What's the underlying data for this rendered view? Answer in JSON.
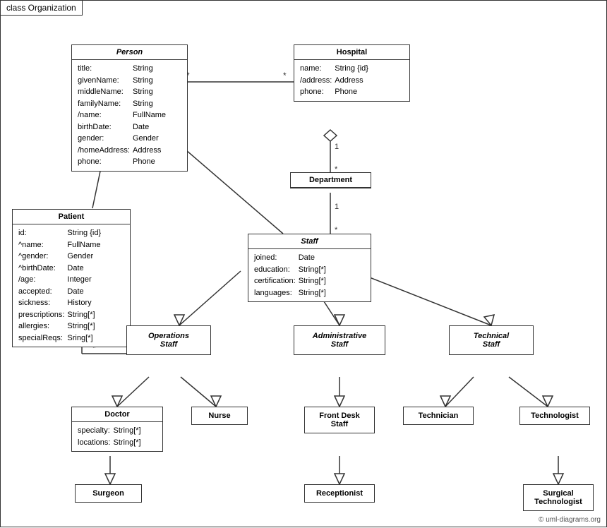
{
  "diagram": {
    "label": "class Organization",
    "classes": {
      "person": {
        "title": "Person",
        "attrs": [
          [
            "title:",
            "String"
          ],
          [
            "givenName:",
            "String"
          ],
          [
            "middleName:",
            "String"
          ],
          [
            "familyName:",
            "String"
          ],
          [
            "/name:",
            "FullName"
          ],
          [
            "birthDate:",
            "Date"
          ],
          [
            "gender:",
            "Gender"
          ],
          [
            "/homeAddress:",
            "Address"
          ],
          [
            "phone:",
            "Phone"
          ]
        ]
      },
      "hospital": {
        "title": "Hospital",
        "attrs": [
          [
            "name:",
            "String {id}"
          ],
          [
            "/address:",
            "Address"
          ],
          [
            "phone:",
            "Phone"
          ]
        ]
      },
      "patient": {
        "title": "Patient",
        "attrs": [
          [
            "id:",
            "String {id}"
          ],
          [
            "^name:",
            "FullName"
          ],
          [
            "^gender:",
            "Gender"
          ],
          [
            "^birthDate:",
            "Date"
          ],
          [
            "/age:",
            "Integer"
          ],
          [
            "accepted:",
            "Date"
          ],
          [
            "sickness:",
            "History"
          ],
          [
            "prescriptions:",
            "String[*]"
          ],
          [
            "allergies:",
            "String[*]"
          ],
          [
            "specialReqs:",
            "Sring[*]"
          ]
        ]
      },
      "department": {
        "title": "Department"
      },
      "staff": {
        "title": "Staff",
        "attrs": [
          [
            "joined:",
            "Date"
          ],
          [
            "education:",
            "String[*]"
          ],
          [
            "certification:",
            "String[*]"
          ],
          [
            "languages:",
            "String[*]"
          ]
        ]
      },
      "operations_staff": {
        "title": "Operations Staff"
      },
      "administrative_staff": {
        "title": "Administrative Staff"
      },
      "technical_staff": {
        "title": "Technical Staff"
      },
      "doctor": {
        "title": "Doctor",
        "attrs": [
          [
            "specialty:",
            "String[*]"
          ],
          [
            "locations:",
            "String[*]"
          ]
        ]
      },
      "nurse": {
        "title": "Nurse"
      },
      "front_desk_staff": {
        "title": "Front Desk Staff"
      },
      "technician": {
        "title": "Technician"
      },
      "technologist": {
        "title": "Technologist"
      },
      "surgeon": {
        "title": "Surgeon"
      },
      "receptionist": {
        "title": "Receptionist"
      },
      "surgical_technologist": {
        "title": "Surgical Technologist"
      }
    },
    "multiplicity": {
      "star": "*",
      "one": "1"
    },
    "copyright": "© uml-diagrams.org"
  }
}
